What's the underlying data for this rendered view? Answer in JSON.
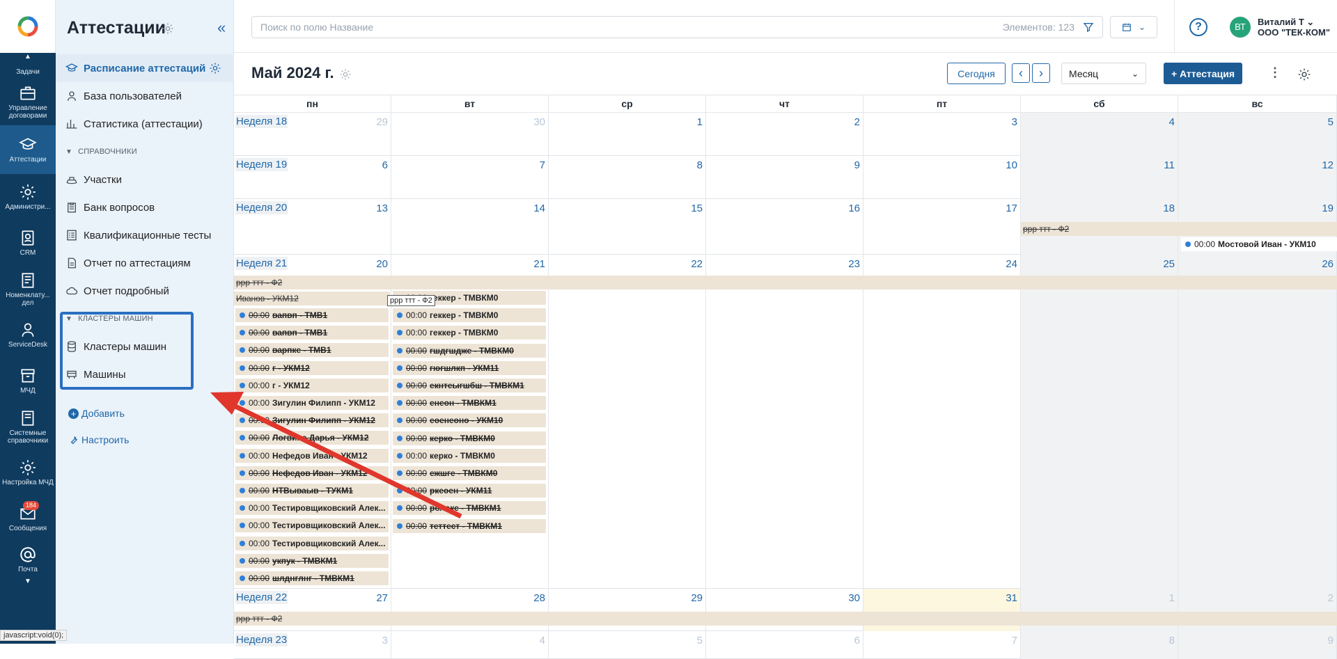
{
  "rail": {
    "items": [
      {
        "label": "Задачи",
        "icon": "tasks-icon"
      },
      {
        "label": "Управление договорами",
        "icon": "briefcase-icon"
      },
      {
        "label": "Аттестации",
        "icon": "graduation-cap-icon",
        "active": true
      },
      {
        "label": "Администри...",
        "icon": "gear-icon"
      },
      {
        "label": "CRM",
        "icon": "crm-icon"
      },
      {
        "label": "Номенклату... дел",
        "icon": "book-icon"
      },
      {
        "label": "ServiceDesk",
        "icon": "support-agent-icon"
      },
      {
        "label": "МЧД",
        "icon": "archive-box-icon"
      },
      {
        "label": "Системные справочники",
        "icon": "book-icon"
      },
      {
        "label": "Настройка МЧД",
        "icon": "gear-icon"
      },
      {
        "label": "Сообщения",
        "icon": "envelope-icon",
        "badge": "184"
      },
      {
        "label": "Почта",
        "icon": "at-icon"
      }
    ]
  },
  "sidebar": {
    "title": "Аттестации",
    "collapse": "«",
    "nav": [
      {
        "label": "Расписание аттестаций",
        "selected": true
      },
      {
        "label": "База пользователей"
      },
      {
        "label": "Статистика (аттестации)"
      }
    ],
    "section1": "СПРАВОЧНИКИ",
    "refs": [
      {
        "label": "Участки"
      },
      {
        "label": "Банк вопросов"
      },
      {
        "label": "Квалификационные тесты"
      },
      {
        "label": "Отчет по аттестациям"
      },
      {
        "label": "Отчет подробный"
      }
    ],
    "section2": "КЛАСТЕРЫ МАШИН",
    "clusters": [
      {
        "label": "Кластеры машин"
      },
      {
        "label": "Машины"
      }
    ],
    "add": "Добавить",
    "configure": "Настроить"
  },
  "topbar": {
    "search_placeholder": "Поиск по полю Название",
    "elements_count": "Элементов: 123",
    "user_initials": "ВТ",
    "user_name": "Виталий Т",
    "user_org": "ООО \"ТЕК-КОМ\"",
    "help": "?"
  },
  "calendar": {
    "month_title": "Май 2024 г.",
    "today_btn": "Сегодня",
    "prev": "‹",
    "next": "›",
    "view": "Месяц",
    "add_btn": "+ Аттестация",
    "weekdays": [
      "пн",
      "вт",
      "ср",
      "чт",
      "пт",
      "сб",
      "вс"
    ],
    "weeks": [
      {
        "label": "Неделя 18",
        "days": [
          "29",
          "30",
          "1",
          "2",
          "3",
          "4",
          "5"
        ]
      },
      {
        "label": "Неделя 19",
        "days": [
          "6",
          "7",
          "8",
          "9",
          "10",
          "11",
          "12"
        ]
      },
      {
        "label": "Неделя 20",
        "days": [
          "13",
          "14",
          "15",
          "16",
          "17",
          "18",
          "19"
        ]
      },
      {
        "label": "Неделя 21",
        "days": [
          "20",
          "21",
          "22",
          "23",
          "24",
          "25",
          "26"
        ]
      },
      {
        "label": "Неделя 22",
        "days": [
          "27",
          "28",
          "29",
          "30",
          "31",
          "1",
          "2"
        ]
      },
      {
        "label": "Неделя 23",
        "days": [
          "3",
          "4",
          "5",
          "6",
          "7",
          "8",
          "9"
        ]
      }
    ],
    "week20_bar": "ррр ттт - Ф2",
    "week20_event": {
      "time": "00:00",
      "name": "Мостовой Иван - УКМ10"
    },
    "week21_bar": "ррр ттт - Ф2",
    "week21_bar2": "Иванов - УКМ12",
    "mon20_events": [
      {
        "time": "00:00",
        "name": "вапвп - ТМВ1",
        "strike": true
      },
      {
        "time": "00:00",
        "name": "вапвп - ТМВ1",
        "strike": true
      },
      {
        "time": "00:00",
        "name": "варпке - ТМВ1",
        "strike": true
      },
      {
        "time": "00:00",
        "name": "г - УКМ12",
        "strike": true
      },
      {
        "time": "00:00",
        "name": "г - УКМ12",
        "strike": false
      },
      {
        "time": "00:00",
        "name": "Зигулин Филипп - УКМ12",
        "strike": false
      },
      {
        "time": "00:00",
        "name": "Зигулин Филипп - УКМ12",
        "strike": true
      },
      {
        "time": "00:00",
        "name": "Логвина Дарья - УКМ12",
        "strike": true
      },
      {
        "time": "00:00",
        "name": "Нефедов Иван - УКМ12",
        "strike": false
      },
      {
        "time": "00:00",
        "name": "Нефедов Иван - УКМ12",
        "strike": true
      },
      {
        "time": "00:00",
        "name": "НТВываыв - ТУКМ1",
        "strike": true
      },
      {
        "time": "00:00",
        "name": "Тестировщиковский Алек...",
        "strike": false
      },
      {
        "time": "00:00",
        "name": "Тестировщиковский Алек...",
        "strike": false
      },
      {
        "time": "00:00",
        "name": "Тестировщиковский Алек...",
        "strike": false
      },
      {
        "time": "00:00",
        "name": "укпук - ТМВКМ1",
        "strike": true
      },
      {
        "time": "00:00",
        "name": "шлднглнг - ТМВКМ1",
        "strike": true
      }
    ],
    "tue21_events": [
      {
        "time": "00:00",
        "name": "геккер - ТМВКМ0",
        "strike": false
      },
      {
        "time": "00:00",
        "name": "геккер - ТМВКМ0",
        "strike": false
      },
      {
        "time": "00:00",
        "name": "геккер - ТМВКМ0",
        "strike": false
      },
      {
        "time": "00:00",
        "name": "гшдгшдже - ТМВКМ0",
        "strike": true
      },
      {
        "time": "00:00",
        "name": "гюгшлкп - УКМ11",
        "strike": true
      },
      {
        "time": "00:00",
        "name": "екнтеыгшбш - ТМВКМ1",
        "strike": true
      },
      {
        "time": "00:00",
        "name": "енеон - ТМВКМ1",
        "strike": true
      },
      {
        "time": "00:00",
        "name": "еоенеоно - УКМ10",
        "strike": true
      },
      {
        "time": "00:00",
        "name": "керко - ТМВКМ0",
        "strike": true
      },
      {
        "time": "00:00",
        "name": "керко - ТМВКМ0",
        "strike": false
      },
      {
        "time": "00:00",
        "name": "ежшге - ТМВКМ0",
        "strike": true
      },
      {
        "time": "00:00",
        "name": "ркеоен - УКМ11",
        "strike": true
      },
      {
        "time": "00:00",
        "name": "ролоке - ТМВКМ1",
        "strike": true
      },
      {
        "time": "00:00",
        "name": "теттест - ТМВКМ1",
        "strike": true
      }
    ],
    "week22_bar": "ррр ттт - Ф2",
    "tooltip": "ррр ттт - Ф2"
  },
  "status_bar": "javascript:void(0);",
  "colors": {
    "rail": "#0f3b5f",
    "accent": "#2068a8",
    "event_bg": "#ede4d6",
    "highlight": "#2a6fc1",
    "arrow": "#e0362c"
  }
}
